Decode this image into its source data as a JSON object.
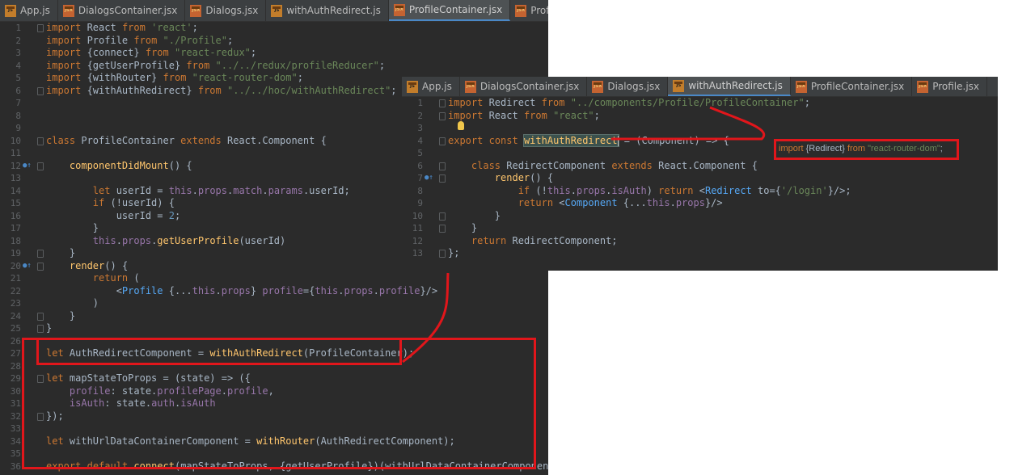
{
  "editor_main": {
    "tabs": [
      {
        "label": "App.js",
        "icon": "js-file-icon",
        "badge": "JS",
        "active": false
      },
      {
        "label": "DialogsContainer.jsx",
        "icon": "jsx-file-icon",
        "badge": "JSX",
        "active": false
      },
      {
        "label": "Dialogs.jsx",
        "icon": "jsx-file-icon",
        "badge": "JSX",
        "active": false
      },
      {
        "label": "withAuthRedirect.js",
        "icon": "js-file-icon",
        "badge": "JS",
        "active": false
      },
      {
        "label": "ProfileContainer.jsx",
        "icon": "jsx-file-icon",
        "badge": "JSX",
        "active": true
      },
      {
        "label": "Profile",
        "icon": "jsx-file-icon",
        "badge": "JSX",
        "active": false
      }
    ],
    "lines": [
      {
        "n": "1",
        "t": "import React from 'react';"
      },
      {
        "n": "2",
        "t": "import Profile from \"./Profile\";"
      },
      {
        "n": "3",
        "t": "import {connect} from \"react-redux\";"
      },
      {
        "n": "4",
        "t": "import {getUserProfile} from \"../../redux/profileReducer\";"
      },
      {
        "n": "5",
        "t": "import {withRouter} from \"react-router-dom\";"
      },
      {
        "n": "6",
        "t": "import {withAuthRedirect} from \"../../hoc/withAuthRedirect\";"
      },
      {
        "n": "7",
        "t": ""
      },
      {
        "n": "8",
        "t": ""
      },
      {
        "n": "9",
        "t": ""
      },
      {
        "n": "10",
        "t": "class ProfileContainer extends React.Component {"
      },
      {
        "n": "11",
        "t": ""
      },
      {
        "n": "12",
        "t": "    componentDidMount() {"
      },
      {
        "n": "13",
        "t": ""
      },
      {
        "n": "14",
        "t": "        let userId = this.props.match.params.userId;"
      },
      {
        "n": "15",
        "t": "        if (!userId) {"
      },
      {
        "n": "16",
        "t": "            userId = 2;"
      },
      {
        "n": "17",
        "t": "        }"
      },
      {
        "n": "18",
        "t": "        this.props.getUserProfile(userId)"
      },
      {
        "n": "19",
        "t": "    }"
      },
      {
        "n": "20",
        "t": "    render() {"
      },
      {
        "n": "21",
        "t": "        return ("
      },
      {
        "n": "22",
        "t": "            <Profile {...this.props} profile={this.props.profile}/>"
      },
      {
        "n": "23",
        "t": "        )"
      },
      {
        "n": "24",
        "t": "    }"
      },
      {
        "n": "25",
        "t": "}"
      },
      {
        "n": "26",
        "t": ""
      },
      {
        "n": "27",
        "t": "let AuthRedirectComponent = withAuthRedirect(ProfileContainer);"
      },
      {
        "n": "28",
        "t": ""
      },
      {
        "n": "29",
        "t": "let mapStateToProps = (state) => ({"
      },
      {
        "n": "30",
        "t": "    profile: state.profilePage.profile,"
      },
      {
        "n": "31",
        "t": "    isAuth: state.auth.isAuth"
      },
      {
        "n": "32",
        "t": "});"
      },
      {
        "n": "33",
        "t": ""
      },
      {
        "n": "34",
        "t": "let withUrlDataContainerComponent = withRouter(AuthRedirectComponent);"
      },
      {
        "n": "35",
        "t": ""
      },
      {
        "n": "36",
        "t": "export default connect(mapStateToProps, {getUserProfile})(withUrlDataContainerComponent);"
      }
    ]
  },
  "editor_overlay": {
    "tabs": [
      {
        "label": "App.js",
        "icon": "js-file-icon",
        "badge": "JS",
        "active": false
      },
      {
        "label": "DialogsContainer.jsx",
        "icon": "jsx-file-icon",
        "badge": "JSX",
        "active": false
      },
      {
        "label": "Dialogs.jsx",
        "icon": "jsx-file-icon",
        "badge": "JSX",
        "active": false
      },
      {
        "label": "withAuthRedirect.js",
        "icon": "js-file-icon",
        "badge": "JS",
        "active": true
      },
      {
        "label": "ProfileContainer.jsx",
        "icon": "jsx-file-icon",
        "badge": "JSX",
        "active": false
      },
      {
        "label": "Profile.jsx",
        "icon": "jsx-file-icon",
        "badge": "JSX",
        "active": false
      }
    ],
    "lines": [
      {
        "n": "1",
        "t": "import Redirect from \"../components/Profile/ProfileContainer\";"
      },
      {
        "n": "2",
        "t": "import React from \"react\";"
      },
      {
        "n": "3",
        "t": ""
      },
      {
        "n": "4",
        "t": "export const withAuthRedirect = (Component) => {"
      },
      {
        "n": "5",
        "t": ""
      },
      {
        "n": "6",
        "t": "    class RedirectComponent extends React.Component {"
      },
      {
        "n": "7",
        "t": "        render() {"
      },
      {
        "n": "8",
        "t": "            if (!this.props.isAuth) return <Redirect to={'/login'}/>;"
      },
      {
        "n": "9",
        "t": "            return <Component {...this.props}/>"
      },
      {
        "n": "10",
        "t": "        }"
      },
      {
        "n": "11",
        "t": "    }"
      },
      {
        "n": "12",
        "t": "    return RedirectComponent;"
      },
      {
        "n": "13",
        "t": "};"
      }
    ]
  },
  "annotation": {
    "kw1": "import",
    "name": "{Redirect}",
    "kw2": "from",
    "module": "\"react-router-dom\"",
    "end": ";"
  },
  "colors": {
    "accent": "#e1161b",
    "editor_bg": "#2b2b2b",
    "tabbar_bg": "#3c3f41"
  }
}
